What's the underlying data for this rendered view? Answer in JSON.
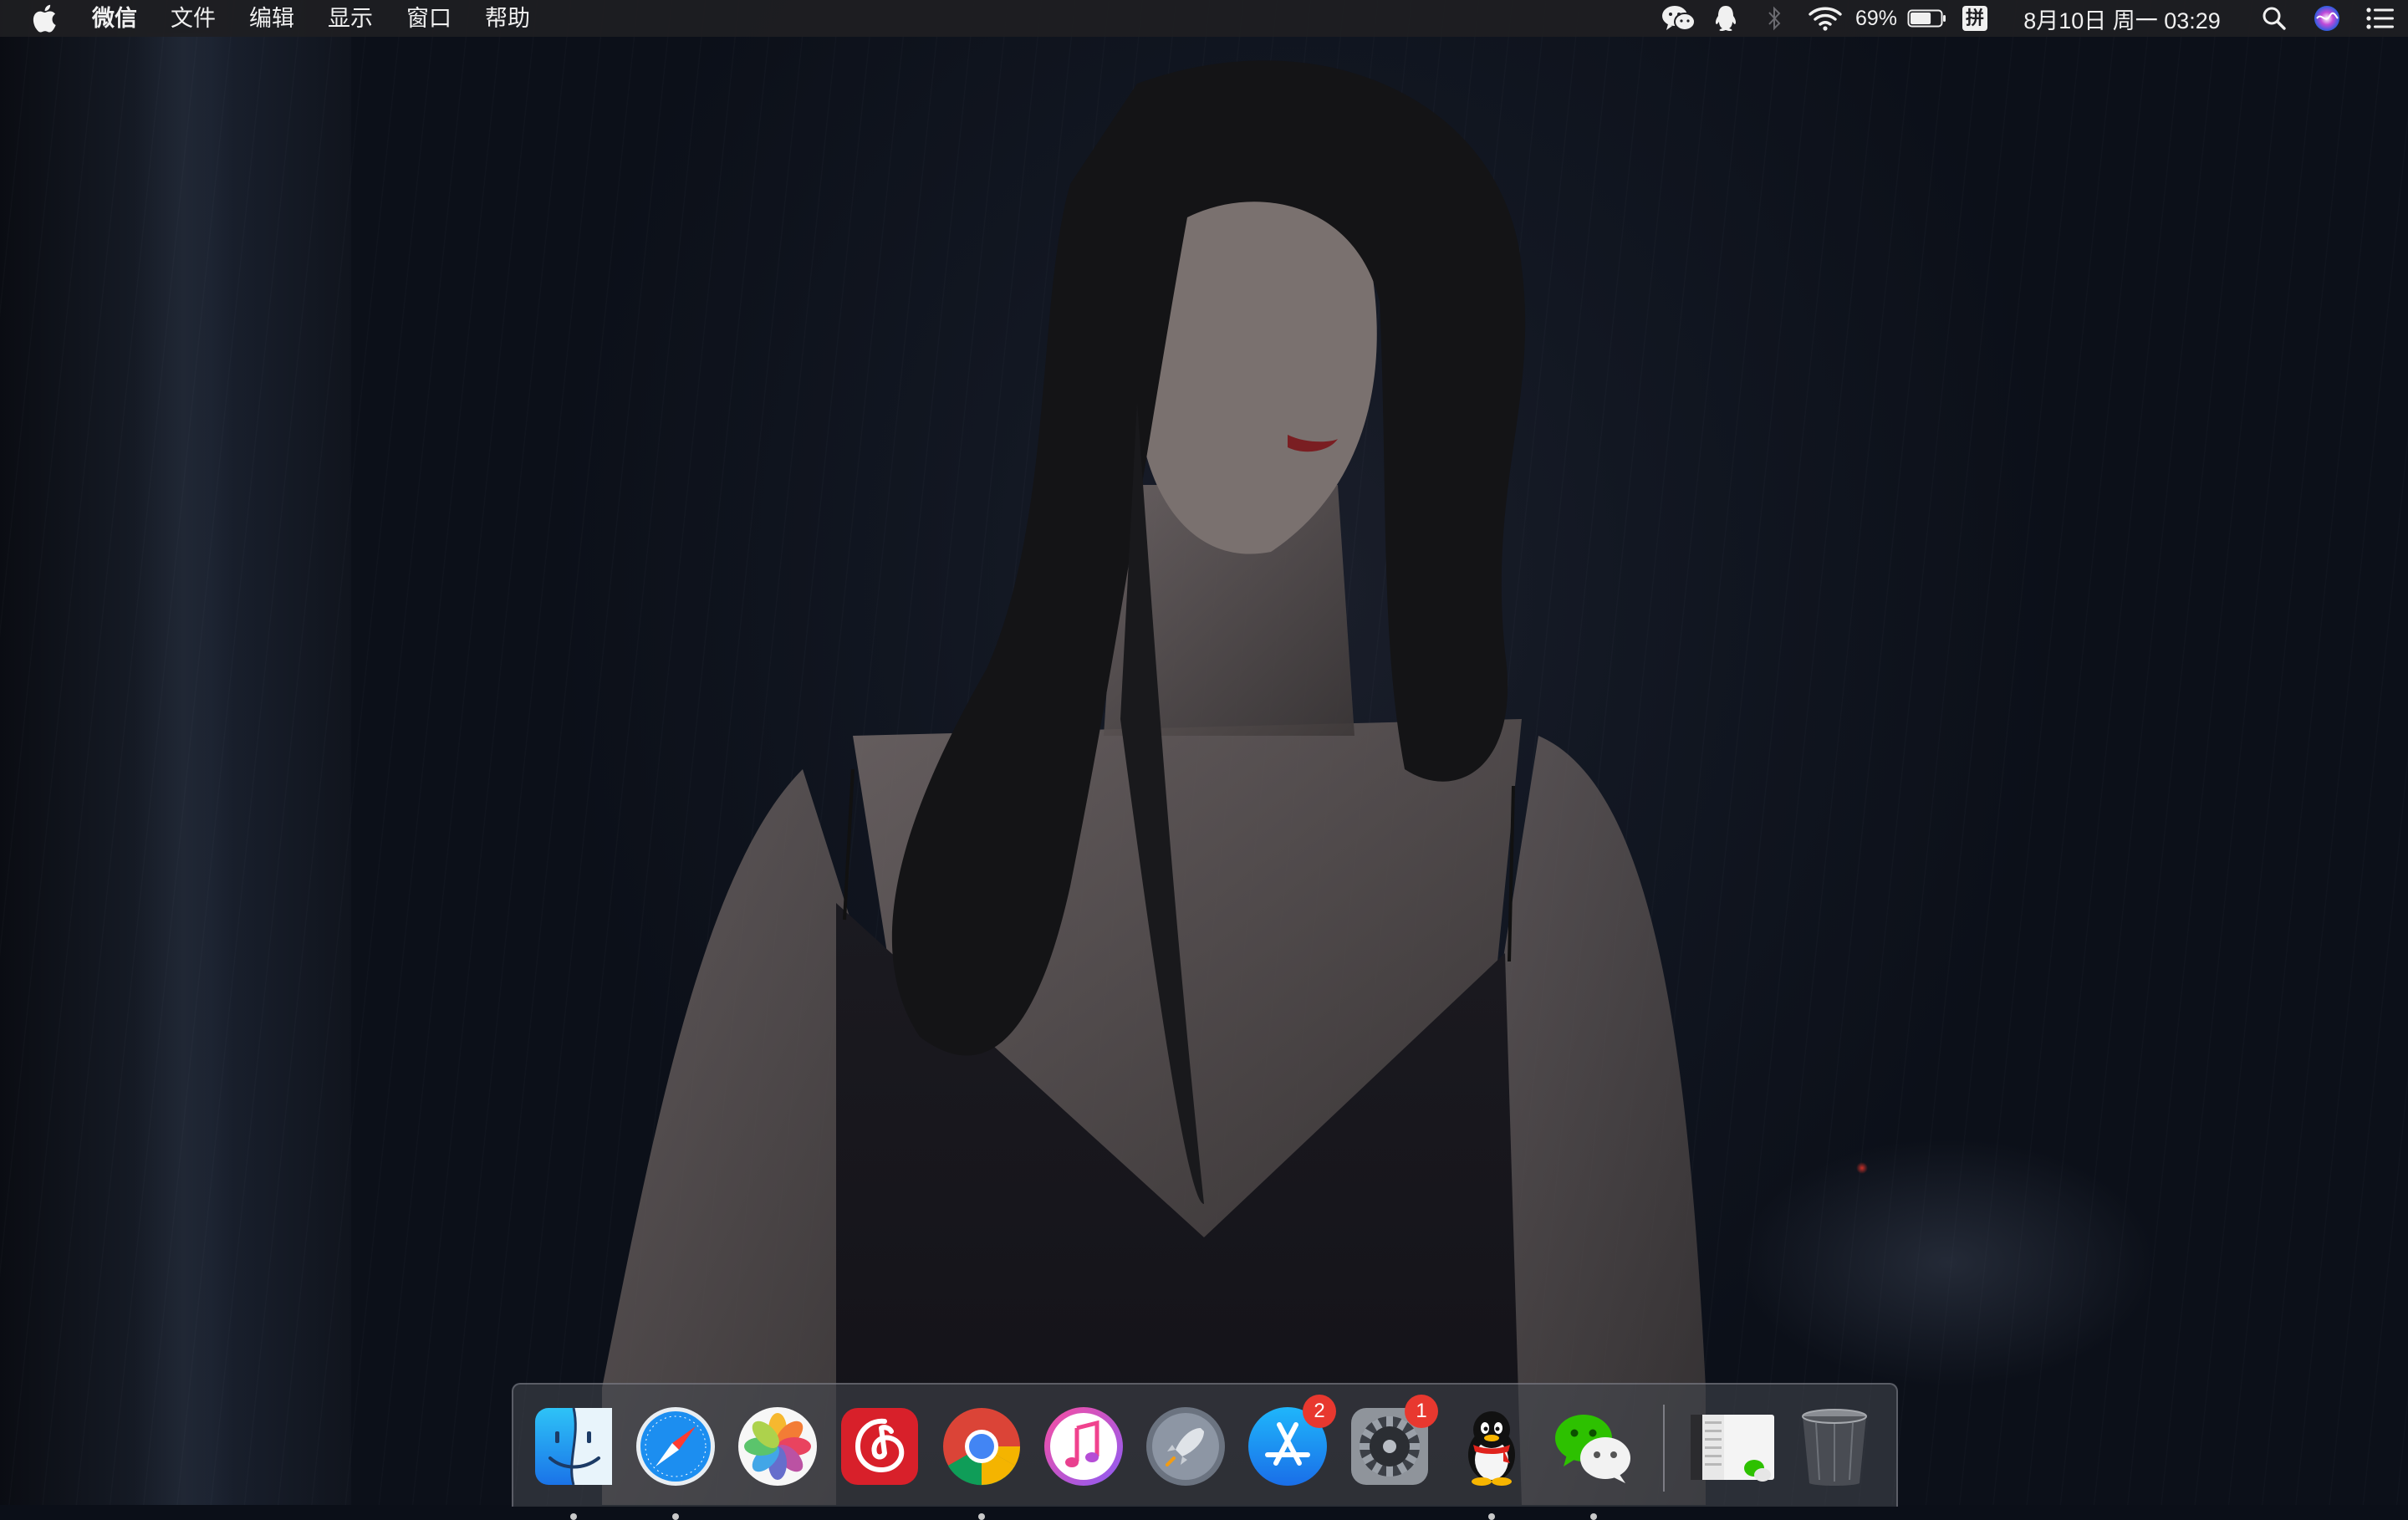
{
  "menubar": {
    "app_name": "微信",
    "menus": [
      "文件",
      "编辑",
      "显示",
      "窗口",
      "帮助"
    ],
    "status": {
      "battery_percent": "69%",
      "battery_level": 0.69,
      "input_method": "拼",
      "datetime": "8月10日 周一  03:29",
      "icons": [
        "wechat-icon",
        "qq-icon",
        "bluetooth-icon",
        "wifi-icon",
        "battery-icon",
        "input-method-icon",
        "search-icon",
        "siri-icon",
        "notification-center-icon"
      ]
    }
  },
  "dock": {
    "apps": [
      {
        "name": "Finder",
        "running": true
      },
      {
        "name": "Safari",
        "running": true
      },
      {
        "name": "Photos",
        "running": false
      },
      {
        "name": "NetEase Cloud Music",
        "running": false
      },
      {
        "name": "Google Chrome",
        "running": true
      },
      {
        "name": "iTunes",
        "running": false
      },
      {
        "name": "Launchpad",
        "running": false
      },
      {
        "name": "App Store",
        "running": false,
        "badge": "2"
      },
      {
        "name": "System Preferences",
        "running": false,
        "badge": "1"
      },
      {
        "name": "QQ",
        "running": true
      },
      {
        "name": "WeChat",
        "running": true
      }
    ],
    "extras": [
      "minimized-wechat-window",
      "trash"
    ]
  },
  "colors": {
    "menubar_bg": "#1e1e22",
    "badge": "#e8382f",
    "wechat_green": "#2dc100",
    "netease_red": "#d8202a"
  }
}
